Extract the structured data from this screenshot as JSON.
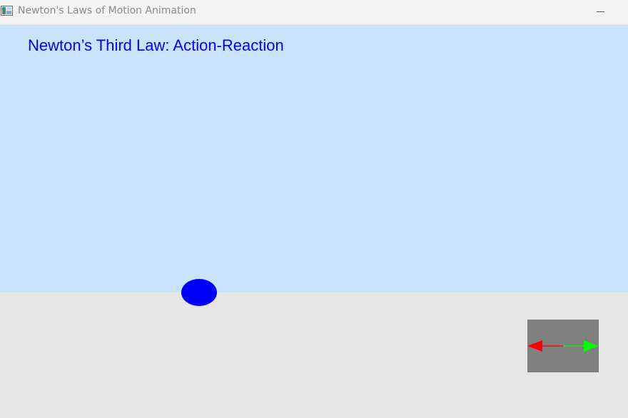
{
  "window": {
    "title": "Newton's Laws of Motion Animation",
    "icon": "app-window-icon",
    "controls": [
      "minimize-icon"
    ]
  },
  "scene": {
    "heading": "Newton’s Third Law: Action-Reaction",
    "colors": {
      "sky": "#cae3fc",
      "ground": "#e6e6e6",
      "heading": "#0000ff",
      "ball": "#0000ff",
      "block": "#808080",
      "action_arrow": "#ff0000",
      "reaction_arrow": "#00ff00"
    },
    "ball": {
      "icon": "ball-shape"
    },
    "block": {
      "icon": "block-shape"
    },
    "forces": {
      "action": {
        "direction": "left",
        "icon": "arrow-left-icon"
      },
      "reaction": {
        "direction": "right",
        "icon": "arrow-right-icon"
      }
    }
  }
}
